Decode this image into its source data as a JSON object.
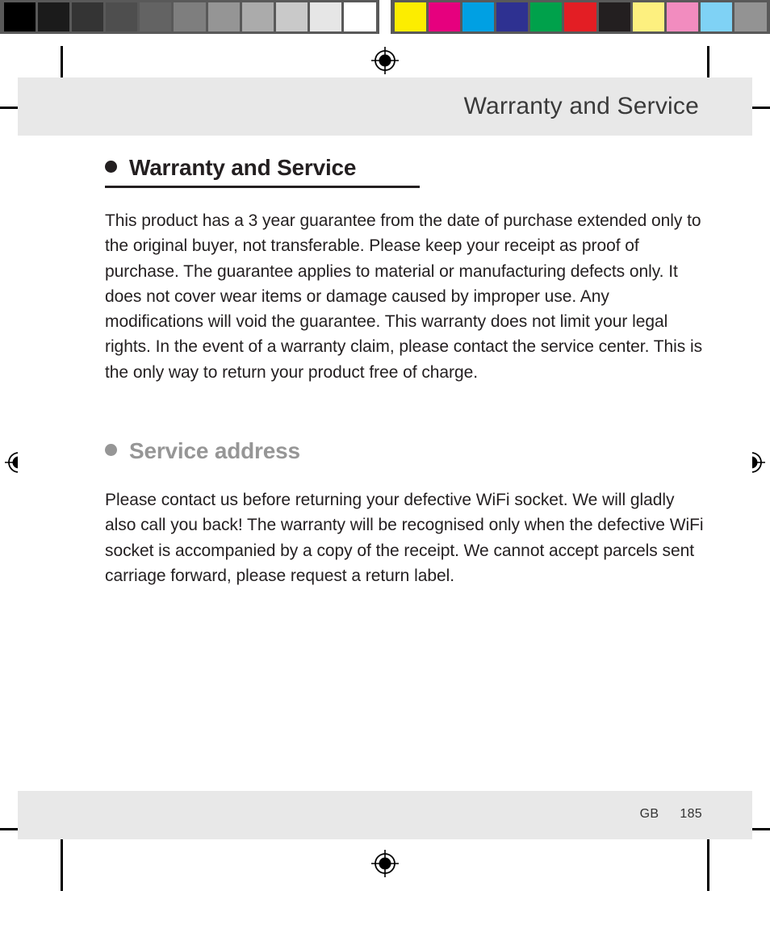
{
  "calibration": {
    "grayscale_label": "grayscale-calibration-strip",
    "grayscale_patches": [
      "#000000",
      "#1b1b1b",
      "#343434",
      "#4e4e4e",
      "#636363",
      "#7e7e7e",
      "#959595",
      "#ababab",
      "#c9c9c9",
      "#e6e6e6",
      "#ffffff"
    ],
    "color_label": "color-calibration-strip",
    "color_patches": [
      "#fced00",
      "#e6007e",
      "#00a0e3",
      "#2e3191",
      "#00a14b",
      "#e31e24",
      "#231f20",
      "#fdf07f",
      "#f28cbf",
      "#7fd2f5",
      "#939393"
    ]
  },
  "marks": {
    "registration_icon": "registration-crosshair-icon",
    "crop_icon": "crop-mark-icon"
  },
  "header": {
    "running_head": "Warranty and Service"
  },
  "footer": {
    "locale": "GB",
    "page_number": "185"
  },
  "content": {
    "heading_warranty": "Warranty and Service",
    "paragraph_warranty": "This product has a 3 year guarantee from the date of purchase extended only to the original buyer, not transferable. Please keep your receipt as proof of purchase. The guarantee applies to material or manufacturing defects only. It does not cover wear items or damage caused by improper use. Any modifications will void the guarantee. This warranty does not limit your legal rights. In the event of a warranty claim, please contact the service center. This is the only way to return your product free of charge.",
    "heading_service": "Service address",
    "paragraph_service": "Please contact us before returning your defective WiFi socket. We will gladly also call you back! The warranty will be recognised only when the defective WiFi socket is accompanied by a copy of the receipt. We cannot accept parcels sent carriage forward, please request a return label."
  },
  "colors": {
    "band_gray": "#e8e8e8",
    "text_dark": "#231f20",
    "heading_gray": "#969696",
    "running_head": "#3a3a3a",
    "strip_background": "#595959"
  }
}
